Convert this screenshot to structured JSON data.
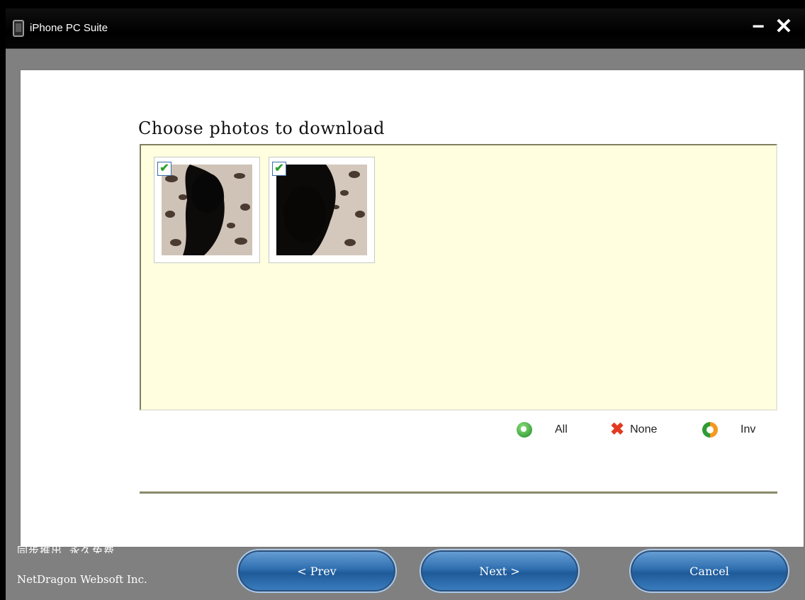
{
  "window": {
    "title": "iPhone PC Suite",
    "minimize_glyph": "−",
    "close_glyph": "✕"
  },
  "main": {
    "heading": "Choose photos to download"
  },
  "photos": [
    {
      "checked": true,
      "check_glyph": "✔"
    },
    {
      "checked": true,
      "check_glyph": "✔"
    }
  ],
  "selection": {
    "all_label": "All",
    "none_label": "None",
    "inv_label": "Inv",
    "icons": {
      "all": "refresh-green-icon",
      "none": "red-x-icon",
      "inv": "invert-icon"
    }
  },
  "footer": {
    "line1": "同步推出 永久免费",
    "company": "NetDragon Websoft Inc.",
    "prev_label": "< Prev",
    "next_label": "Next >",
    "cancel_label": "Cancel"
  },
  "colors": {
    "panel_bg": "#ffffe0",
    "button_blue": "#2f6fb0",
    "window_gray": "#808080"
  }
}
